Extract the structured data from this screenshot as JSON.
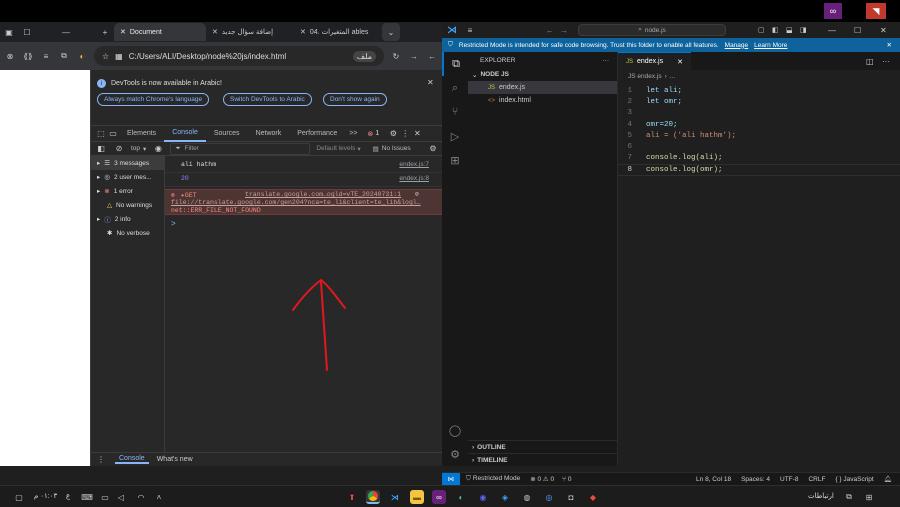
{
  "browser": {
    "tabs": [
      {
        "title": "Document"
      },
      {
        "title": "إضافة سؤال جديد"
      },
      {
        "title": "04. المتغيرات ables"
      }
    ],
    "url": "C:/Users/ALI/Desktop/node%20js/index.html",
    "url_prefix": "ملف",
    "page_viewport_color": "#ffffff"
  },
  "devtools": {
    "info_message": "DevTools is now available in Arabic!",
    "info_buttons": [
      "Always match Chrome's language",
      "Switch DevTools to Arabic",
      "Don't show again"
    ],
    "tabs": [
      "Elements",
      "Console",
      "Sources",
      "Network",
      "Performance"
    ],
    "more_tabs": ">>",
    "error_count": "1",
    "context": "top",
    "filter_placeholder": "Filter",
    "default_levels": "Default levels",
    "no_issues": "No Issues",
    "sidebar": [
      {
        "label": "3 messages",
        "icon": "list-icon"
      },
      {
        "label": "2 user mes...",
        "icon": "user-icon"
      },
      {
        "label": "1 error",
        "icon": "error-icon"
      },
      {
        "label": "No warnings",
        "icon": "warning-icon"
      },
      {
        "label": "2 info",
        "icon": "info-icon"
      },
      {
        "label": "No verbose",
        "icon": "bug-icon"
      }
    ],
    "console_lines": [
      {
        "text": "ali hathm",
        "source": "endex.js:7"
      },
      {
        "text": "20",
        "source": "endex.js:8"
      }
    ],
    "error": {
      "method": "GET",
      "short_url": "translate.google.com…ogld=vTE_20240731:1",
      "full_url": "file://translate.google.com/gen204?nca=te_li&client=te_lib&logl…",
      "message": "net::ERR_FILE_NOT_FOUND"
    },
    "prompt": ">",
    "drawer_tabs": [
      "Console",
      "What's new"
    ]
  },
  "vscode": {
    "search_text": "node.js",
    "restricted_message": "Restricted Mode is intended for safe code browsing. Trust this folder to enable all features.",
    "restricted_links": [
      "Manage",
      "Learn More"
    ],
    "explorer_title": "EXPLORER",
    "folder": "NODE JS",
    "files": [
      {
        "name": "endex.js",
        "type": "JS"
      },
      {
        "name": "index.html",
        "type": "<>"
      }
    ],
    "outline": "OUTLINE",
    "timeline": "TIMELINE",
    "active_tab": "endex.js",
    "breadcrumb": [
      "JS endex.js",
      "..."
    ],
    "code_lines": [
      {
        "n": "1",
        "code": "let ali;"
      },
      {
        "n": "2",
        "code": "let omr;"
      },
      {
        "n": "3",
        "code": ""
      },
      {
        "n": "4",
        "code": "omr=20;"
      },
      {
        "n": "5",
        "code": "ali = ('ali hathm');"
      },
      {
        "n": "6",
        "code": ""
      },
      {
        "n": "7",
        "code": "console.log(ali);"
      },
      {
        "n": "8",
        "code": "console.log(omr);"
      }
    ],
    "status": {
      "restricted": "Restricted Mode",
      "problems": "⊗ 0 ⚠ 0",
      "ports": "⑂ 0",
      "position": "Ln 8, Col 18",
      "spaces": "Spaces: 4",
      "encoding": "UTF-8",
      "eol": "CRLF",
      "language": "{ } JavaScript"
    }
  },
  "taskbar": {
    "time": "٠١:٠٣ م",
    "lang": "ع",
    "links": "ارتباطات"
  },
  "colors": {
    "accent": "#0078d4",
    "restricted_bar": "#0e639c",
    "error_bg": "#4e3534",
    "arrow": "#e0191f"
  }
}
